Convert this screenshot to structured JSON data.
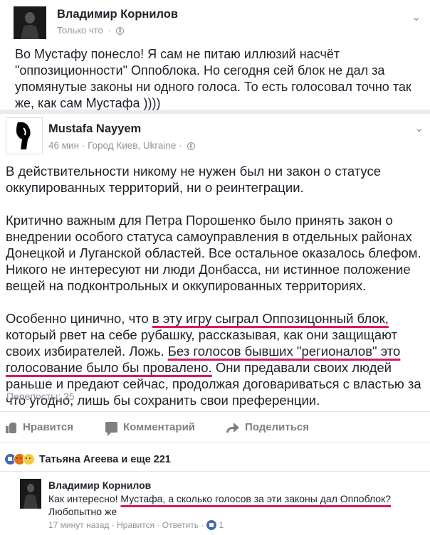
{
  "post1": {
    "author": "Владимир Корнилов",
    "time": "Только что",
    "text": "Во Мустафу понесло! Я сам не питаю иллюзий насчёт \"оппозиционности\" Оппоблока. Но сегодня сей блок не дал за упомянутые законы ни одного голоса. То есть голосовал точно так же, как сам Мустафа ))))"
  },
  "post2": {
    "author": "Mustafa Nayyem",
    "time": "46 мин",
    "location": "Город Киев, Ukraine",
    "para1": "В действительности никому не нужен был ни закон о статусе оккупированных территорий, ни о реинтеграции.",
    "para2": "Критично важным для Петра Порошенко было принять закон о внедрении особого статуса самоуправления в отдельных районах Донецкой и Луганской областей. Все остальное оказалось блефом. Никого не интересуют ни люди Донбасса, ни истинное положение вещей на подконтрольных и оккупированных территориях.",
    "para3_a": "Особенно цинично, что ",
    "para3_b": "в эту игру сыграл Оппозицонный блок,",
    "para3_c": " который рвет на себе рубашку, рассказывая, как они защищают своих избирателей. Ложь. ",
    "para3_d": "Без голосов бывших  \"регионалов\" это голосование было бы провалено.",
    "para3_e": " Они предавали своих людей раньше и предают сейчас, продолжая договариваться с властью за что угодно, лишь бы сохранить свои преференции.",
    "shares": "Перепосты: 25"
  },
  "actions": {
    "like": "Нравится",
    "comment": "Комментарий",
    "share": "Поделиться"
  },
  "reactions": {
    "text": "Татьяна Агеева и еще 221"
  },
  "comment": {
    "author": "Владимир Корнилов",
    "text_a": "Как интересно! ",
    "text_b": "Мустафа, а сколько голосов за эти законы дал Оппоблок?",
    "text_c": " Любопытно же",
    "time": "17 минут назад",
    "like": "Нравится",
    "reply": "Ответить",
    "likes": "1"
  },
  "colors": {
    "underline": "#d81b60",
    "like_badge": "#4267b2"
  }
}
